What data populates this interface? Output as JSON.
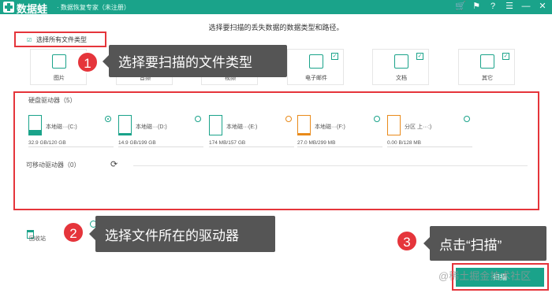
{
  "app": {
    "name": "数据蛙",
    "subtitle": "· 数据恢复专家（未注册）"
  },
  "titlebar_icons": [
    "cart-icon",
    "flag-icon",
    "help-icon",
    "menu-icon",
    "minimize-icon",
    "close-icon"
  ],
  "instruction": "选择要扫描的丢失数据的数据类型和路径。",
  "select_all": {
    "label": "选择所有文件类型",
    "checked": true
  },
  "file_types": [
    {
      "label": "图片",
      "checked": false
    },
    {
      "label": "音频",
      "checked": false
    },
    {
      "label": "视频",
      "checked": false
    },
    {
      "label": "电子邮件",
      "checked": true
    },
    {
      "label": "文档",
      "checked": true
    },
    {
      "label": "其它",
      "checked": true
    }
  ],
  "drives_section": {
    "hard_title": "硬盘驱动器（5）",
    "drives": [
      {
        "name": "本地磁···(C:)",
        "size": "32.9 GB/120 GB",
        "fill": 0.27,
        "color": "#1aa38a",
        "selected": true
      },
      {
        "name": "本地磁···(D:)",
        "size": "14.9 GB/199 GB",
        "fill": 0.07,
        "color": "#1aa38a",
        "selected": false
      },
      {
        "name": "本地磁···(E:)",
        "size": "174 MB/157 GB",
        "fill": 0.01,
        "color": "#1aa38a",
        "selected": false
      },
      {
        "name": "本地磁···(F:)",
        "size": "27.0 MB/299 MB",
        "fill": 0.09,
        "color": "#e98a1a",
        "selected": false
      },
      {
        "name": "分区 上···:)",
        "size": "0.00  B/128 MB",
        "fill": 0.0,
        "color": "#e98a1a",
        "selected": false
      }
    ],
    "removable_title": "可移动驱动器（0）"
  },
  "recycle": {
    "label": "回收站"
  },
  "annotations": {
    "step1": {
      "num": "1",
      "text": "选择要扫描的文件类型"
    },
    "step2": {
      "num": "2",
      "text": "选择文件所在的驱动器"
    },
    "step3": {
      "num": "3",
      "text": "点击“扫描”"
    }
  },
  "scan_button": "扫描",
  "watermark": "@稀土掘金技术社区",
  "colors": {
    "accent": "#1aa38a",
    "highlight": "#e5353b",
    "callout": "#555555"
  }
}
